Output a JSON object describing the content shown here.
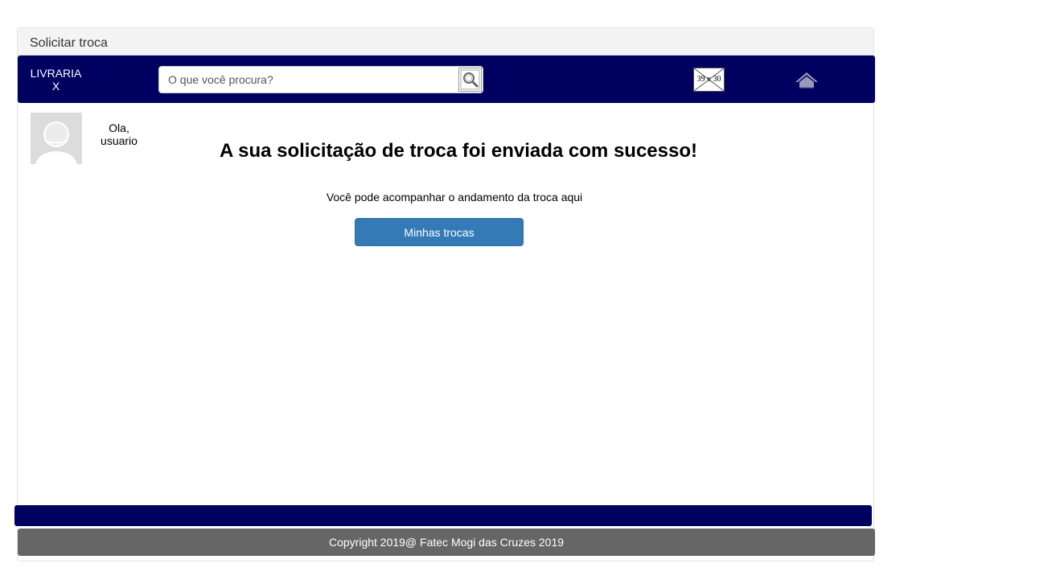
{
  "window": {
    "title": "Solicitar troca"
  },
  "navbar": {
    "brand_line1": "LIVRARIA",
    "brand_line2": "X",
    "search_placeholder": "O que você procura?",
    "image_placeholder_label": "39 x 30",
    "search_icon": "search-icon",
    "home_icon": "home-icon",
    "color": "#000060"
  },
  "user": {
    "greeting_line1": "Ola,",
    "greeting_line2": "usuario",
    "avatar_icon": "avatar-icon"
  },
  "main": {
    "headline": "A sua solicitação de troca foi enviada com sucesso!",
    "subtext": "Você pode acompanhar o andamento da troca aqui",
    "button_label": "Minhas trocas",
    "button_color": "#337ab7"
  },
  "footer": {
    "copyright": "Copyright 2019@ Fatec Mogi das Cruzes 2019",
    "bar_color": "#000060",
    "copyright_bg": "#666666"
  }
}
